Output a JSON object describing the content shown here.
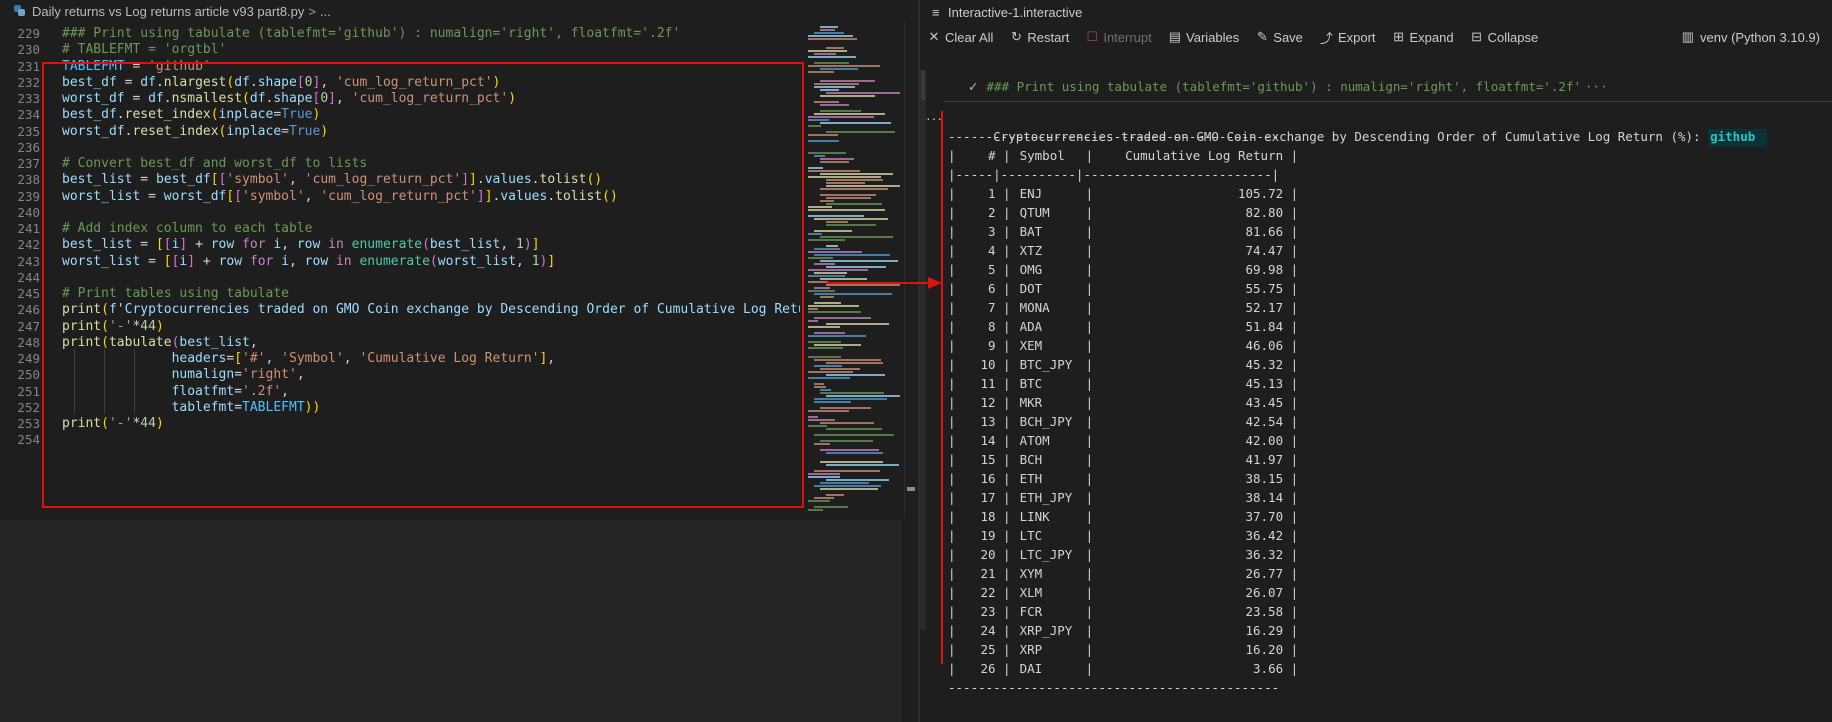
{
  "editor": {
    "breadcrumb": {
      "file": "Daily returns vs Log returns article v93 part8.py",
      "separator": ">",
      "trail": "..."
    },
    "lines": [
      {
        "n": "229",
        "code": "### Print using tabulate (tablefmt='github') : numalign='right', floatfmt='.2f'"
      },
      {
        "n": "230",
        "code": "# TABLEFMT = 'orgtbl'"
      },
      {
        "n": "231",
        "code": "TABLEFMT = 'github'"
      },
      {
        "n": "232",
        "code": "best_df = df.nlargest(df.shape[0], 'cum_log_return_pct')"
      },
      {
        "n": "233",
        "code": "worst_df = df.nsmallest(df.shape[0], 'cum_log_return_pct')"
      },
      {
        "n": "234",
        "code": "best_df.reset_index(inplace=True)"
      },
      {
        "n": "235",
        "code": "worst_df.reset_index(inplace=True)"
      },
      {
        "n": "236",
        "code": ""
      },
      {
        "n": "237",
        "code": "# Convert best_df and worst_df to lists"
      },
      {
        "n": "238",
        "code": "best_list = best_df[['symbol', 'cum_log_return_pct']].values.tolist()"
      },
      {
        "n": "239",
        "code": "worst_list = worst_df[['symbol', 'cum_log_return_pct']].values.tolist()"
      },
      {
        "n": "240",
        "code": ""
      },
      {
        "n": "241",
        "code": "# Add index column to each table"
      },
      {
        "n": "242",
        "code": "best_list = [[i] + row for i, row in enumerate(best_list, 1)]"
      },
      {
        "n": "243",
        "code": "worst_list = [[i] + row for i, row in enumerate(worst_list, 1)]"
      },
      {
        "n": "244",
        "code": ""
      },
      {
        "n": "245",
        "code": "# Print tables using tabulate"
      },
      {
        "n": "246",
        "code": "print(f'Cryptocurrencies traded on GMO Coin exchange by Descending Order of Cumulative Log Retur"
      },
      {
        "n": "247",
        "code": "print('-'*44)"
      },
      {
        "n": "248",
        "code": "print(tabulate(best_list,"
      },
      {
        "n": "249",
        "code": "              headers=['#', 'Symbol', 'Cumulative Log Return'],"
      },
      {
        "n": "250",
        "code": "              numalign='right',"
      },
      {
        "n": "251",
        "code": "              floatfmt='.2f',"
      },
      {
        "n": "252",
        "code": "              tablefmt=TABLEFMT))"
      },
      {
        "n": "253",
        "code": "print('-'*44)"
      },
      {
        "n": "254",
        "code": ""
      }
    ]
  },
  "interactive": {
    "tab_title": "Interactive-1.interactive",
    "toolbar": [
      {
        "id": "clear-all",
        "icon": "close-icon",
        "glyph": "✕",
        "label": "Clear All",
        "disabled": false
      },
      {
        "id": "restart",
        "icon": "restart-icon",
        "glyph": "↻",
        "label": "Restart",
        "disabled": false
      },
      {
        "id": "interrupt",
        "icon": "interrupt-icon",
        "glyph": "☐",
        "label": "Interrupt",
        "disabled": true
      },
      {
        "id": "variables",
        "icon": "variables-icon",
        "glyph": "▤",
        "label": "Variables",
        "disabled": false
      },
      {
        "id": "save",
        "icon": "save-icon",
        "glyph": "✎",
        "label": "Save",
        "disabled": false
      },
      {
        "id": "export",
        "icon": "export-icon",
        "glyph": "⤴",
        "label": "Export",
        "disabled": false
      },
      {
        "id": "expand",
        "icon": "expand-icon",
        "glyph": "⊞",
        "label": "Expand",
        "disabled": false
      },
      {
        "id": "collapse",
        "icon": "collapse-icon",
        "glyph": "⊟",
        "label": "Collapse",
        "disabled": false
      }
    ],
    "kernel": {
      "glyph": "▥",
      "label": "venv (Python 3.10.9)"
    },
    "cell_input": {
      "check": "✓",
      "text": "### Print using tabulate (tablefmt='github') : numalign='right', floatfmt='.2f'",
      "ellipsis": "···"
    },
    "output_dots": "···",
    "output": {
      "title_prefix": "Cryptocurrencies traded on GMO Coin exchange by Descending Order of Cumulative Log Return (%): ",
      "title_highlight": "github",
      "rule": "--------------------------------------------",
      "headers": [
        "#",
        "Symbol",
        "Cumulative Log Return"
      ],
      "header_sep": "|-----|----------|-------------------------|",
      "rows": [
        {
          "idx": "1",
          "symbol": "ENJ",
          "value": "105.72"
        },
        {
          "idx": "2",
          "symbol": "QTUM",
          "value": "82.80"
        },
        {
          "idx": "3",
          "symbol": "BAT",
          "value": "81.66"
        },
        {
          "idx": "4",
          "symbol": "XTZ",
          "value": "74.47"
        },
        {
          "idx": "5",
          "symbol": "OMG",
          "value": "69.98"
        },
        {
          "idx": "6",
          "symbol": "DOT",
          "value": "55.75"
        },
        {
          "idx": "7",
          "symbol": "MONA",
          "value": "52.17"
        },
        {
          "idx": "8",
          "symbol": "ADA",
          "value": "51.84"
        },
        {
          "idx": "9",
          "symbol": "XEM",
          "value": "46.06"
        },
        {
          "idx": "10",
          "symbol": "BTC_JPY",
          "value": "45.32"
        },
        {
          "idx": "11",
          "symbol": "BTC",
          "value": "45.13"
        },
        {
          "idx": "12",
          "symbol": "MKR",
          "value": "43.45"
        },
        {
          "idx": "13",
          "symbol": "BCH_JPY",
          "value": "42.54"
        },
        {
          "idx": "14",
          "symbol": "ATOM",
          "value": "42.00"
        },
        {
          "idx": "15",
          "symbol": "BCH",
          "value": "41.97"
        },
        {
          "idx": "16",
          "symbol": "ETH",
          "value": "38.15"
        },
        {
          "idx": "17",
          "symbol": "ETH_JPY",
          "value": "38.14"
        },
        {
          "idx": "18",
          "symbol": "LINK",
          "value": "37.70"
        },
        {
          "idx": "19",
          "symbol": "LTC",
          "value": "36.42"
        },
        {
          "idx": "20",
          "symbol": "LTC_JPY",
          "value": "36.32"
        },
        {
          "idx": "21",
          "symbol": "XYM",
          "value": "26.77"
        },
        {
          "idx": "22",
          "symbol": "XLM",
          "value": "26.07"
        },
        {
          "idx": "23",
          "symbol": "FCR",
          "value": "23.58"
        },
        {
          "idx": "24",
          "symbol": "XRP_JPY",
          "value": "16.29"
        },
        {
          "idx": "25",
          "symbol": "XRP",
          "value": "16.20"
        },
        {
          "idx": "26",
          "symbol": "DAI",
          "value": "3.66"
        }
      ]
    }
  },
  "colors": {
    "annotation_red": "#e01010",
    "background": "#1e1e1e",
    "comment_green": "#6a9955",
    "string_orange": "#ce9178",
    "variable_blue": "#9cdcfe",
    "highlight_cyan": "#29c6c6"
  }
}
